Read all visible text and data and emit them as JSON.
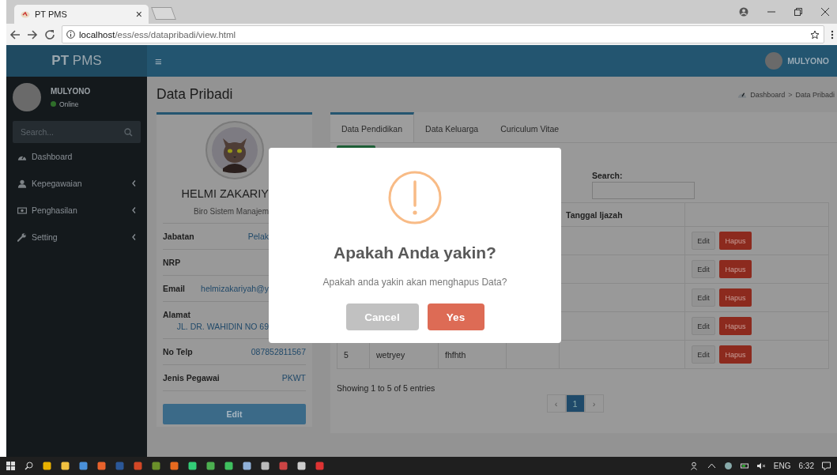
{
  "browser": {
    "tab": {
      "title": "PT PMS",
      "close": "×"
    },
    "address": {
      "host": "localhost",
      "path": "/ess/ess/datapribadi/view.html"
    }
  },
  "header": {
    "menu_toggle": "≡",
    "logo": "**PT** PMS",
    "user": "MULYONO"
  },
  "sidebar": {
    "user": {
      "name": "MULYONO",
      "status": "Online"
    },
    "search": {
      "placeholder": "Search..."
    },
    "items": [
      {
        "label": "Dashboard",
        "kind": "dashboard",
        "expandable": false
      },
      {
        "label": "Kepegawaian",
        "kind": "user",
        "expandable": true
      },
      {
        "label": "Penghasilan",
        "kind": "money",
        "expandable": true
      },
      {
        "label": "Setting",
        "kind": "wrench",
        "expandable": true
      }
    ]
  },
  "page": {
    "title": "Data Pribadi",
    "breadcrumb": [
      "Dashboard",
      "Data Pribadi"
    ],
    "separator": ">"
  },
  "profile": {
    "name": "HELMI ZAKARIY",
    "unit": "Biro Sistem Manajem",
    "cut": true,
    "fields": [
      {
        "label": "Jabatan",
        "value": "Pelak",
        "cut": true,
        "stacked": false
      },
      {
        "label": "NRP",
        "stacked": false
      },
      {
        "label": "Email",
        "value": "helmizakariyah@y",
        "cut": true,
        "stacked": false
      },
      {
        "label": "Alamat",
        "value": "JL. DR. WAHIDIN NO 69",
        "cut": true,
        "stacked": true
      },
      {
        "label": "No Telp",
        "value": "087852811567",
        "cut": false,
        "stacked": false
      },
      {
        "label": "Jenis Pegawai",
        "value": "PKWT",
        "cut": false,
        "stacked": false
      }
    ],
    "edit_button": "Edit"
  },
  "tabs": [
    {
      "label": "Data Pendidikan",
      "selected": true
    },
    {
      "label": "Data Keluarga",
      "selected": false
    },
    {
      "label": "Curiculum Vitae",
      "selected": false
    }
  ],
  "search": {
    "label": "Search:"
  },
  "table": {
    "header": {
      "column_5": "Tanggal Ijazah"
    },
    "rows": [
      {
        "edit": "Edit",
        "delete": "Hapus"
      },
      {
        "edit": "Edit",
        "delete": "Hapus"
      },
      {
        "edit": "Edit",
        "delete": "Hapus"
      },
      {
        "edit": "Edit",
        "delete": "Hapus"
      },
      {
        "cells": [
          "5",
          "wetryey",
          "fhfhth"
        ],
        "edit": "Edit",
        "delete": "Hapus"
      }
    ]
  },
  "info": "Showing 1 to 5 of 5 entries",
  "pagination": {
    "previous": "‹",
    "pages": [
      {
        "label": "1",
        "selected": true
      }
    ],
    "next": "›"
  },
  "dialog": {
    "title": "Apakah Anda yakin?",
    "message": "Apakah anda yakin akan menghapus Data?",
    "buttons": [
      {
        "label": "Cancel",
        "kind": "cancel"
      },
      {
        "label": "Yes",
        "kind": "confirm"
      }
    ]
  },
  "taskbar": {
    "language": "ENG",
    "time": "6:32"
  }
}
